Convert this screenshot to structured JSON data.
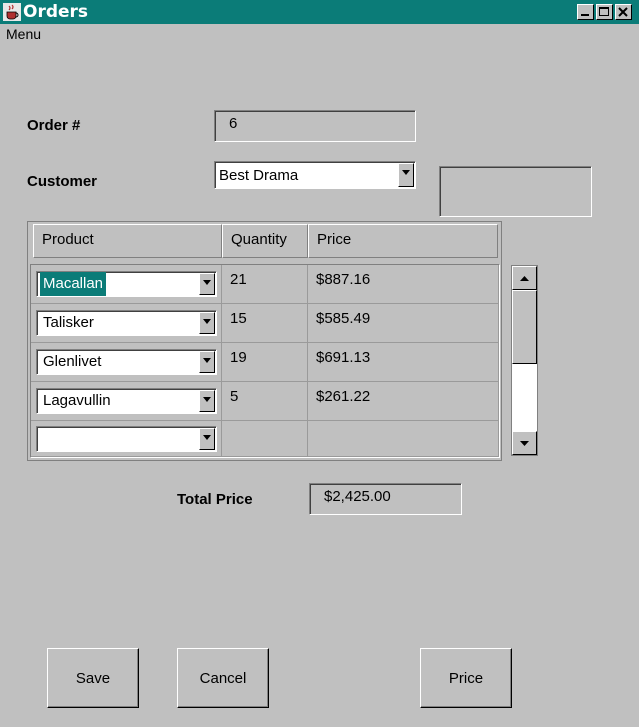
{
  "window": {
    "title": "Orders"
  },
  "menu": {
    "label": "Menu"
  },
  "form": {
    "order_label": "Order #",
    "order_value": "6",
    "customer_label": "Customer",
    "customer_value": "Best Drama",
    "customer_extra": ""
  },
  "table": {
    "headers": [
      "Product",
      "Quantity",
      "Price"
    ],
    "rows": [
      {
        "product": "Macallan",
        "quantity": "21",
        "price": "$887.16",
        "selected": true
      },
      {
        "product": "Talisker",
        "quantity": "15",
        "price": "$585.49"
      },
      {
        "product": "Glenlivet",
        "quantity": "19",
        "price": "$691.13"
      },
      {
        "product": "Lagavullin",
        "quantity": "5",
        "price": "$261.22"
      },
      {
        "product": "",
        "quantity": "",
        "price": ""
      }
    ]
  },
  "total": {
    "label": "Total Price",
    "value": "$2,425.00"
  },
  "buttons": {
    "save": "Save",
    "cancel": "Cancel",
    "price": "Price"
  },
  "colors": {
    "accent": "#0b7c78",
    "background": "#c0c0c0"
  }
}
